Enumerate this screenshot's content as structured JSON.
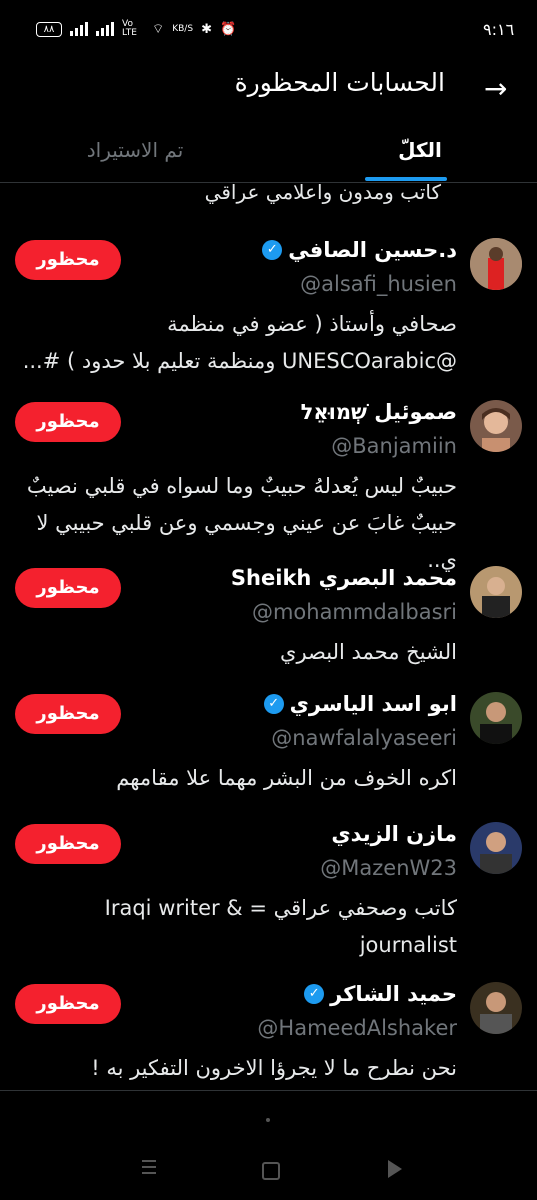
{
  "status": {
    "time": "٩:١٦",
    "battery": "٨٨",
    "net": "KB/S",
    "lte": "Vo LTE"
  },
  "header": {
    "title": "الحسابات المحظورة"
  },
  "tabs": {
    "all": "الكلّ",
    "imported": "تم الاستيراد"
  },
  "partial_bio": "كاتب ومدون واعلامي عراقي",
  "button_label": "محظور",
  "accounts": [
    {
      "name": "د.حسين الصافي",
      "handle": "@alsafi_husien",
      "verified": true,
      "bio": "صحافي وأستاذ ( عضو في منظمة @UNESCOarabic ومنظمة تعليم بلا حدود ) #..."
    },
    {
      "name": "صموئيل שְׁמוּאֵל",
      "handle": "@Banjamiin",
      "verified": false,
      "bio": "حبيبٌ ليس يُعدلهُ حبيبٌ وما لسواه في قلبي نصيبٌ حبيبٌ غابَ عن عيني وجسمي وعن قلبي حبيبي لا ي.."
    },
    {
      "name": "محمد البصري Sheikh",
      "handle": "@mohammdalbasri",
      "verified": false,
      "bio": "الشيخ محمد البصري"
    },
    {
      "name": "ابو اسد الياسري",
      "handle": "@nawfalalyaseeri",
      "verified": true,
      "bio": "اكره الخوف من البشر مهما علا مقامهم"
    },
    {
      "name": "مازن الزيدي",
      "handle": "@MazenW23",
      "verified": false,
      "bio": "كاتب وصحفي عراقي = Iraqi writer & journalist"
    },
    {
      "name": "حميد الشاكر",
      "handle": "@HameedAlshaker",
      "verified": true,
      "bio": "نحن نطرح ما لا يجرؤا الاخرون التفكير به !"
    }
  ],
  "colors": {
    "accent": "#1d9bf0",
    "blocked": "#f4212e",
    "muted": "#71767b"
  }
}
